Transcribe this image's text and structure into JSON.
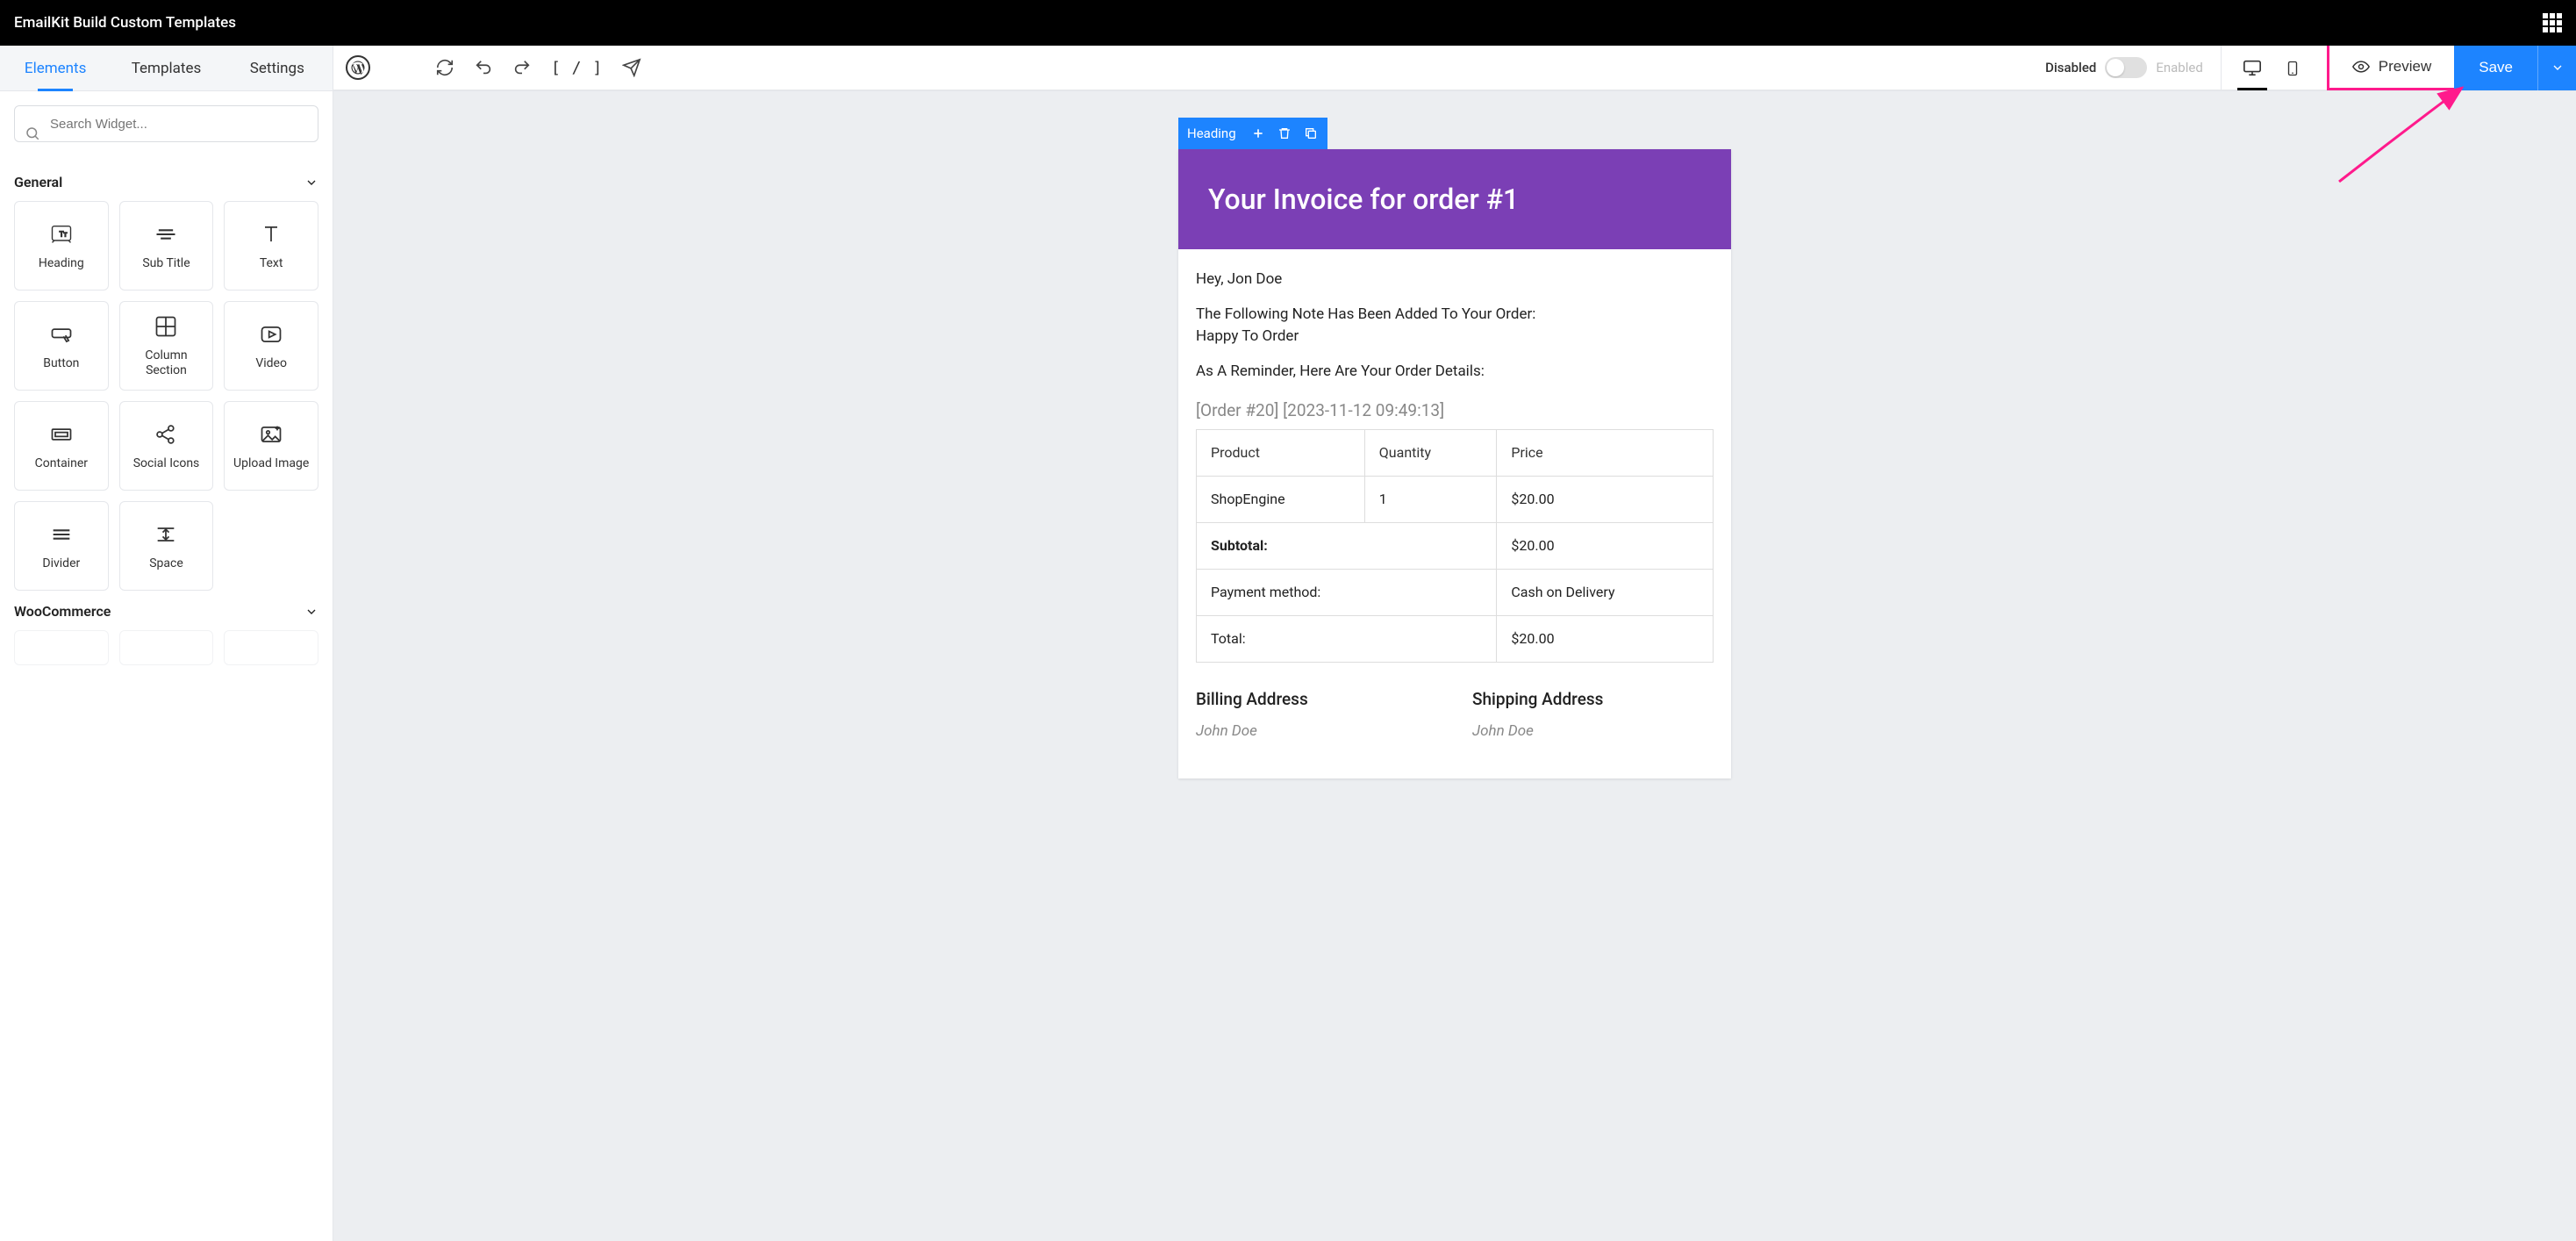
{
  "topbar": {
    "title": "EmailKit Build Custom Templates"
  },
  "toolbar": {
    "shortcode_icon": "[ / ]",
    "toggle_disabled": "Disabled",
    "toggle_enabled": "Enabled",
    "preview_label": "Preview",
    "save_label": "Save"
  },
  "sidebar": {
    "tabs": [
      "Elements",
      "Templates",
      "Settings"
    ],
    "active_tab": 0,
    "search_placeholder": "Search Widget...",
    "sections": [
      {
        "title": "General",
        "widgets": [
          "Heading",
          "Sub Title",
          "Text",
          "Button",
          "Column Section",
          "Video",
          "Container",
          "Social Icons",
          "Upload Image",
          "Divider",
          "Space"
        ]
      },
      {
        "title": "WooCommerce",
        "widgets": []
      }
    ]
  },
  "block_toolbar": {
    "label": "Heading"
  },
  "invoice": {
    "title": "Your Invoice for order #1",
    "greeting": "Hey, Jon Doe",
    "note_intro": "The Following Note Has Been Added To Your Order:",
    "note_body": "Happy To Order",
    "reminder": "As A Reminder, Here Are Your Order Details:",
    "order_meta": "[Order #20] [2023-11-12 09:49:13]",
    "table": {
      "headers": [
        "Product",
        "Quantity",
        "Price"
      ],
      "items": [
        {
          "product": "ShopEngine",
          "quantity": "1",
          "price": "$20.00"
        }
      ],
      "summary": [
        {
          "label": "Subtotal:",
          "value": "$20.00",
          "bold": true
        },
        {
          "label": "Payment method:",
          "value": "Cash on Delivery",
          "bold": false
        },
        {
          "label": "Total:",
          "value": "$20.00",
          "bold": false
        }
      ]
    },
    "billing_title": "Billing Address",
    "shipping_title": "Shipping Address",
    "billing_name": "John Doe",
    "shipping_name": "John Doe"
  }
}
